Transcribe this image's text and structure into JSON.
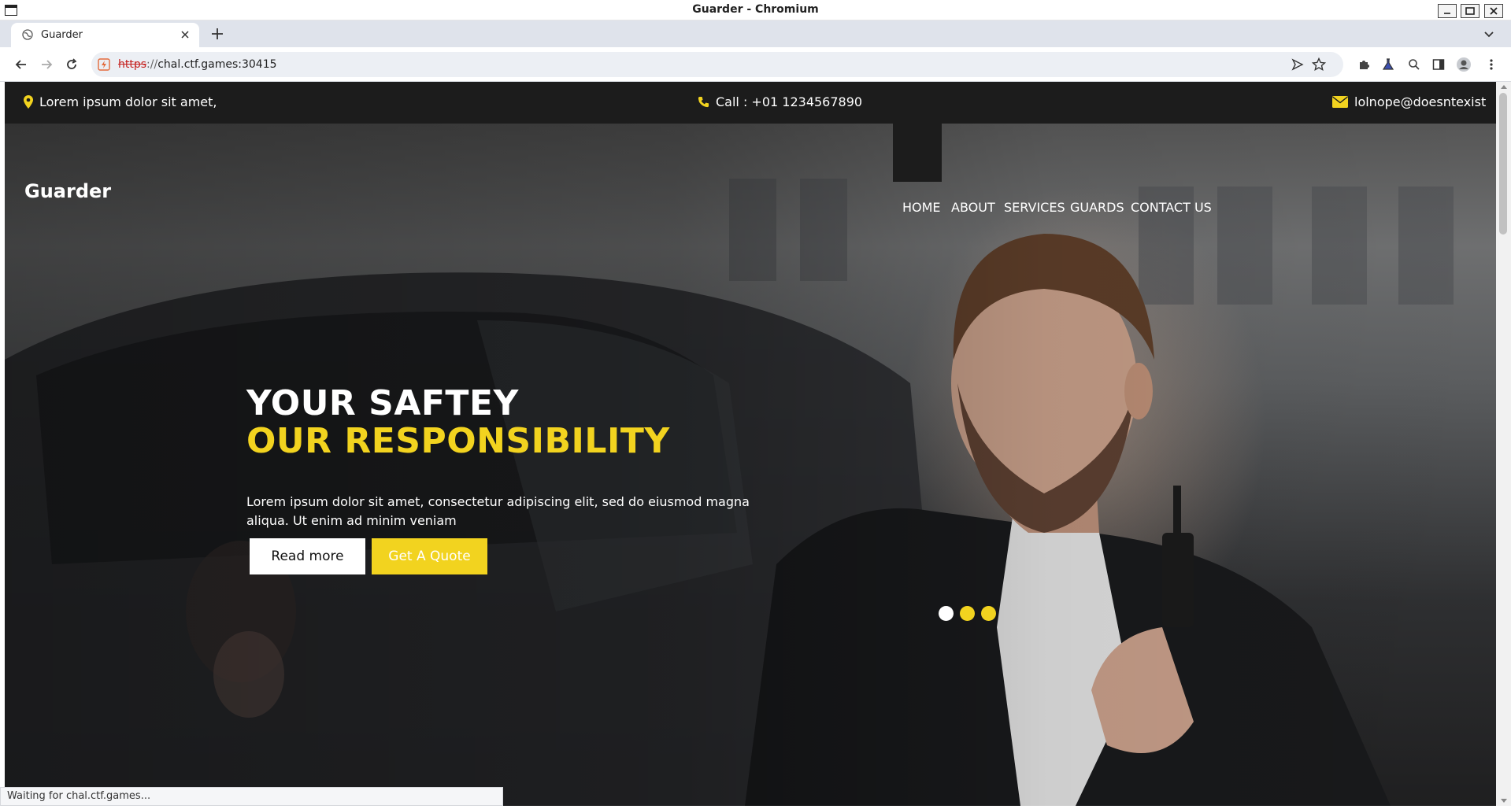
{
  "window": {
    "title": "Guarder - Chromium"
  },
  "tab": {
    "label": "Guarder"
  },
  "address_bar": {
    "scheme": "https",
    "rest": "chal.ctf.games:30415"
  },
  "site": {
    "info_bar": {
      "address": "Lorem ipsum dolor sit amet,",
      "phone": "Call : +01 1234567890",
      "email": "lolnope@doesntexist"
    },
    "brand": "Guarder",
    "nav": [
      "HOME",
      "ABOUT",
      "SERVICES",
      "GUARDS",
      "CONTACT US"
    ],
    "hero": {
      "headline_1": "YOUR SAFTEY",
      "headline_2": "OUR RESPONSIBILITY",
      "lead_1": "Lorem ipsum dolor sit amet, consectetur adipiscing elit, sed do eiusmod magna",
      "lead_2": "aliqua. Ut enim ad minim veniam",
      "read_more": "Read more",
      "get_quote": "Get A Quote",
      "slides": 3,
      "active_slide": 1
    },
    "colors": {
      "accent": "#f2d31f",
      "dark": "#1c1c1c"
    }
  },
  "status": "Waiting for chal.ctf.games..."
}
